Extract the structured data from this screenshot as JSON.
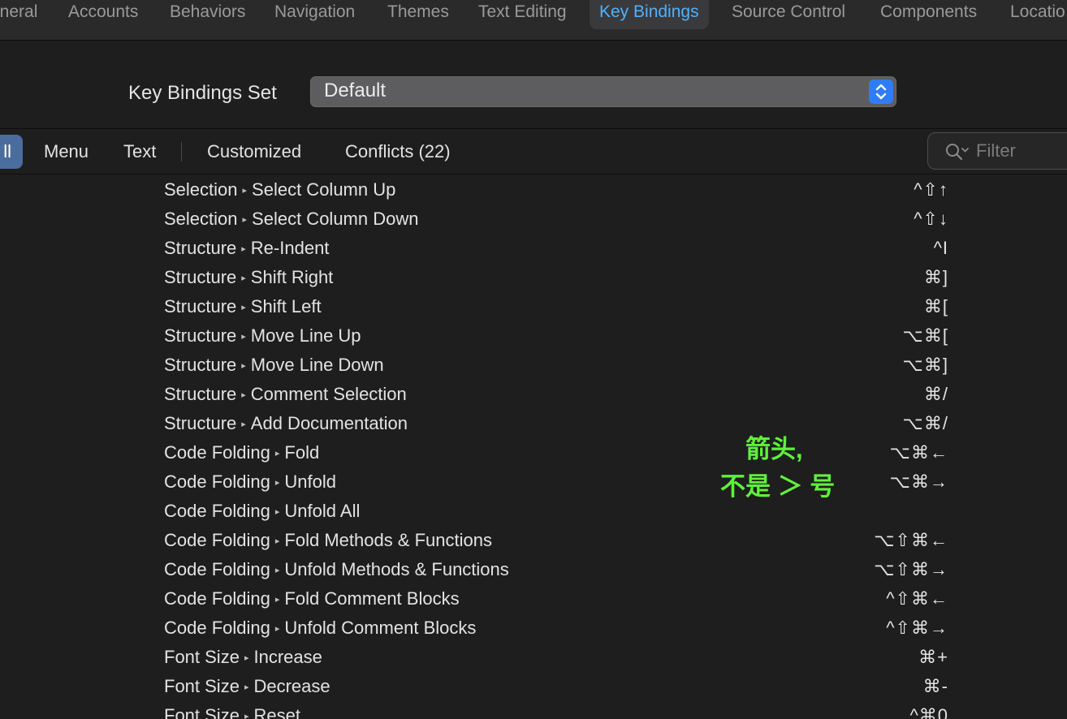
{
  "toolbar": {
    "tabs": [
      {
        "label": "eneral"
      },
      {
        "label": "Accounts"
      },
      {
        "label": "Behaviors"
      },
      {
        "label": "Navigation"
      },
      {
        "label": "Themes"
      },
      {
        "label": "Text Editing"
      },
      {
        "label": "Key Bindings"
      },
      {
        "label": "Source Control"
      },
      {
        "label": "Components"
      },
      {
        "label": "Locatio"
      }
    ]
  },
  "bindings_set": {
    "label": "Key Bindings Set",
    "value": "Default"
  },
  "filter_bar": {
    "all_label": "ll",
    "menu_label": "Menu",
    "text_label": "Text",
    "customized_label": "Customized",
    "conflicts_label": "Conflicts (22)",
    "filter_placeholder": "Filter"
  },
  "commands": [
    {
      "group": "Selection",
      "name": "Select Column Up",
      "key": "^⇧↑"
    },
    {
      "group": "Selection",
      "name": "Select Column Down",
      "key": "^⇧↓"
    },
    {
      "group": "Structure",
      "name": "Re-Indent",
      "key": "^I"
    },
    {
      "group": "Structure",
      "name": "Shift Right",
      "key": "⌘]"
    },
    {
      "group": "Structure",
      "name": "Shift Left",
      "key": "⌘["
    },
    {
      "group": "Structure",
      "name": "Move Line Up",
      "key": "⌥⌘["
    },
    {
      "group": "Structure",
      "name": "Move Line Down",
      "key": "⌥⌘]"
    },
    {
      "group": "Structure",
      "name": "Comment Selection",
      "key": "⌘/"
    },
    {
      "group": "Structure",
      "name": "Add Documentation",
      "key": "⌥⌘/"
    },
    {
      "group": "Code Folding",
      "name": "Fold",
      "key": "⌥⌘←"
    },
    {
      "group": "Code Folding",
      "name": "Unfold",
      "key": "⌥⌘→"
    },
    {
      "group": "Code Folding",
      "name": "Unfold All",
      "key": ""
    },
    {
      "group": "Code Folding",
      "name": "Fold Methods & Functions",
      "key": "⌥⇧⌘←"
    },
    {
      "group": "Code Folding",
      "name": "Unfold Methods & Functions",
      "key": "⌥⇧⌘→"
    },
    {
      "group": "Code Folding",
      "name": "Fold Comment Blocks",
      "key": "^⇧⌘←"
    },
    {
      "group": "Code Folding",
      "name": "Unfold Comment Blocks",
      "key": "^⇧⌘→"
    },
    {
      "group": "Font Size",
      "name": "Increase",
      "key": "⌘+"
    },
    {
      "group": "Font Size",
      "name": "Decrease",
      "key": "⌘-"
    },
    {
      "group": "Font Size",
      "name": "Reset",
      "key": "^⌘0"
    }
  ],
  "annotation": {
    "line1": "箭头,",
    "line2": "不是 ＞ 号"
  },
  "colors": {
    "accent": "#4fb1ff",
    "annotation": "#5ef23a",
    "selected_segment": "#4a6d9e"
  }
}
